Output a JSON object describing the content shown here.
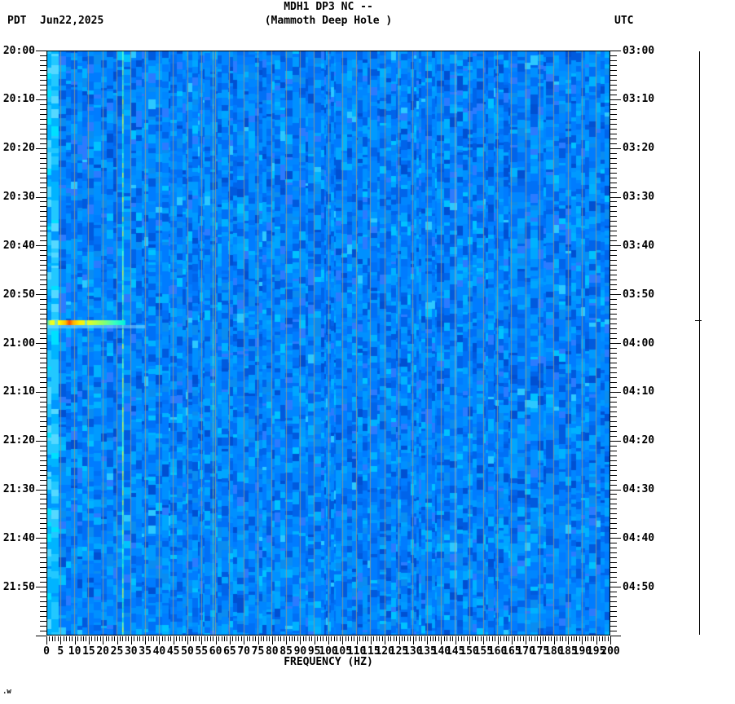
{
  "header": {
    "timezone_left": "PDT",
    "date": "Jun22,2025",
    "title_line1": "MDH1 DP3 NC --",
    "title_line2": "(Mammoth Deep Hole )",
    "timezone_right": "UTC"
  },
  "x_axis": {
    "label": "FREQUENCY (HZ)",
    "min_hz": 0,
    "max_hz": 200,
    "minor_step_hz": 1,
    "major_step_hz": 5,
    "tick_labels": [
      "0",
      "5",
      "10",
      "15",
      "20",
      "25",
      "30",
      "35",
      "40",
      "45",
      "50",
      "55",
      "60",
      "65",
      "70",
      "75",
      "80",
      "85",
      "90",
      "95",
      "100",
      "105",
      "110",
      "115",
      "120",
      "125",
      "130",
      "135",
      "140",
      "145",
      "150",
      "155",
      "160",
      "165",
      "170",
      "175",
      "180",
      "185",
      "190",
      "195",
      "200"
    ]
  },
  "y_axis_left": {
    "timezone": "PDT",
    "minor_step_minutes": 1,
    "major_step_minutes": 10,
    "tick_labels": [
      "20:00",
      "20:10",
      "20:20",
      "20:30",
      "20:40",
      "20:50",
      "21:00",
      "21:10",
      "21:20",
      "21:30",
      "21:40",
      "21:50"
    ]
  },
  "y_axis_right": {
    "timezone": "UTC",
    "minor_step_minutes": 1,
    "major_step_minutes": 10,
    "tick_labels": [
      "03:00",
      "03:10",
      "03:20",
      "03:30",
      "03:40",
      "03:50",
      "04:00",
      "04:10",
      "04:20",
      "04:30",
      "04:40",
      "04:50"
    ]
  },
  "footer_artifact": ".w",
  "chart_data": {
    "type": "heatmap",
    "subtype": "seismic-spectrogram",
    "station": "MDH1 DP3 NC",
    "station_name": "Mammoth Deep Hole",
    "date": "Jun22,2025",
    "freq_range_hz": [
      0,
      200
    ],
    "time_start_pdt": "20:00",
    "time_end_pdt": "22:00",
    "time_start_utc": "03:00",
    "time_end_utc": "05:00",
    "grid_step_hz": 5,
    "gridline_color": "#93988c",
    "background_description": "random mosaic of blue noise, brighter cyan band below 2 Hz",
    "background_palette": [
      [
        "#005ade",
        2
      ],
      [
        "#0064ea",
        3
      ],
      [
        "#0070f6",
        4
      ],
      [
        "#007cff",
        5
      ],
      [
        "#0086ff",
        5
      ],
      [
        "#0090ff",
        4
      ],
      [
        "#009aff",
        3
      ],
      [
        "#00a6ff",
        2
      ],
      [
        "#00b2ff",
        1.2
      ],
      [
        "#00c2ff",
        0.5
      ],
      [
        "#2cc8ff",
        0.25
      ],
      [
        "#0050d2",
        1
      ],
      [
        "#2b7bff",
        1.2
      ],
      [
        "#0a8cf0",
        1.5
      ]
    ],
    "low_freq_edge_palette": [
      [
        "#00b4ff",
        3
      ],
      [
        "#22c8ff",
        3
      ],
      [
        "#55d8ff",
        2
      ],
      [
        "#0096ff",
        2
      ],
      [
        "#00e0ff",
        1
      ]
    ],
    "features": [
      {
        "kind": "tonal-line",
        "freq_hz": 27,
        "description": "persistent narrowband tone, full duration, bright cyan-green",
        "segment_colors": [
          "#3cf0be",
          "#5cffc8",
          "#8cff9b",
          "#c0ff5a",
          "#20e6d2"
        ]
      },
      {
        "kind": "tonal-line",
        "freq_hz": 59,
        "description": "faint power-line hum, yellow-green",
        "segment_colors": [
          "#b9e060",
          "#cde870",
          "#a8d84e"
        ]
      },
      {
        "kind": "broadband-event",
        "time_pdt": "20:55",
        "time_utc": "03:55",
        "freq_span_hz": [
          0,
          28
        ],
        "description": "strong low-frequency burst, yellow-orange core near 8 Hz fading to green/cyan by 28 Hz",
        "gradient_stops": [
          [
            0,
            "#00d8ff"
          ],
          [
            0.05,
            "#e8ff28"
          ],
          [
            0.16,
            "#ffff00"
          ],
          [
            0.24,
            "#ffc400"
          ],
          [
            0.29,
            "#ff4800"
          ],
          [
            0.34,
            "#ffb400"
          ],
          [
            0.42,
            "#fff000"
          ],
          [
            0.56,
            "#d4ff32"
          ],
          [
            0.72,
            "#8aff6e"
          ],
          [
            0.86,
            "#3affc0"
          ],
          [
            1,
            "#00f0e0"
          ]
        ],
        "afterglow_span_hz": [
          0,
          35
        ],
        "afterglow_color": "#8fe2ff"
      }
    ],
    "scale_bar": {
      "present": true,
      "marker_time_pdt": "20:55",
      "color": "#000000"
    }
  }
}
